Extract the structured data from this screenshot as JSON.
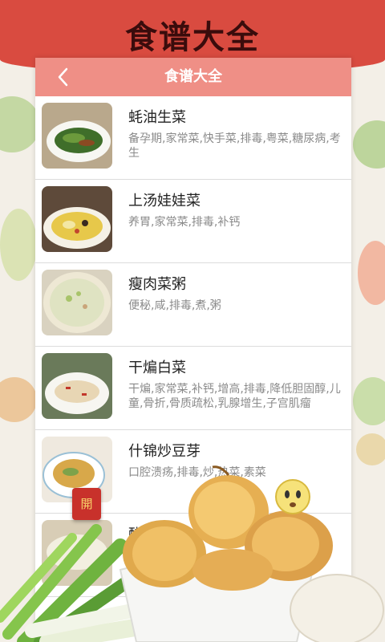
{
  "banner": {
    "title": "食谱大全"
  },
  "app": {
    "title": "食谱大全",
    "back_icon": "chevron-left-icon"
  },
  "recipes": [
    {
      "title": "蚝油生菜",
      "tags": "备孕期,家常菜,快手菜,排毒,粤菜,糖尿病,考生"
    },
    {
      "title": "上汤娃娃菜",
      "tags": "养胃,家常菜,排毒,补钙"
    },
    {
      "title": "瘦肉菜粥",
      "tags": "便秘,咸,排毒,煮,粥"
    },
    {
      "title": "干煸白菜",
      "tags": "干煸,家常菜,补钙,增高,排毒,降低胆固醇,儿童,骨折,骨质疏松,乳腺增生,子宫肌瘤"
    },
    {
      "title": "什锦炒豆芽",
      "tags": "口腔溃疡,排毒,炒,热菜,素菜"
    },
    {
      "title": "醋溜白菜",
      "tags": ""
    }
  ],
  "badge": {
    "label": "開"
  },
  "colors": {
    "banner": "#d94b40",
    "header": "#ef8f86",
    "badge": "#c8312b"
  }
}
